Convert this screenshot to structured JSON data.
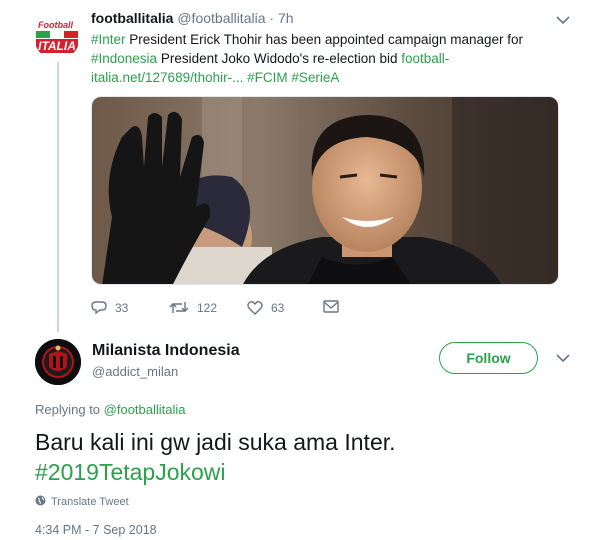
{
  "tweet1": {
    "avatar_text_top": "Football",
    "avatar_text_bottom": "ITALIA",
    "name": "footballitalia",
    "handle": "@footballitalia",
    "separator": "·",
    "time": "7h",
    "text_parts": {
      "tag_inter": "#Inter",
      "t1": " President Erick Thohir has been appointed campaign manager for ",
      "tag_indonesia": "#Indonesia",
      "t2": " President Joko Widodo's re-election bid ",
      "link": "football-italia.net/127689/thohir-...",
      "t3": " ",
      "tag_fcim": "#FCIM",
      "t4": " ",
      "tag_seriea": "#SerieA"
    },
    "actions": {
      "replies": "33",
      "retweets": "122",
      "likes": "63"
    }
  },
  "tweet2": {
    "name": "Milanista Indonesia",
    "handle": "@addict_milan",
    "follow_label": "Follow",
    "replying_prefix": "Replying to ",
    "replying_to": "@footballitalia",
    "body_line1": "Baru kali ini gw jadi suka ama Inter.",
    "body_hashtag": "#2019TetapJokowi",
    "translate_label": "Translate Tweet",
    "timestamp": "4:34 PM - 7 Sep 2018"
  },
  "colors": {
    "accent": "#2ca14d",
    "muted": "#657786",
    "text": "#14171a"
  },
  "icons": [
    "chevron-down-icon",
    "reply-icon",
    "retweet-icon",
    "like-icon",
    "message-icon",
    "globe-icon"
  ]
}
